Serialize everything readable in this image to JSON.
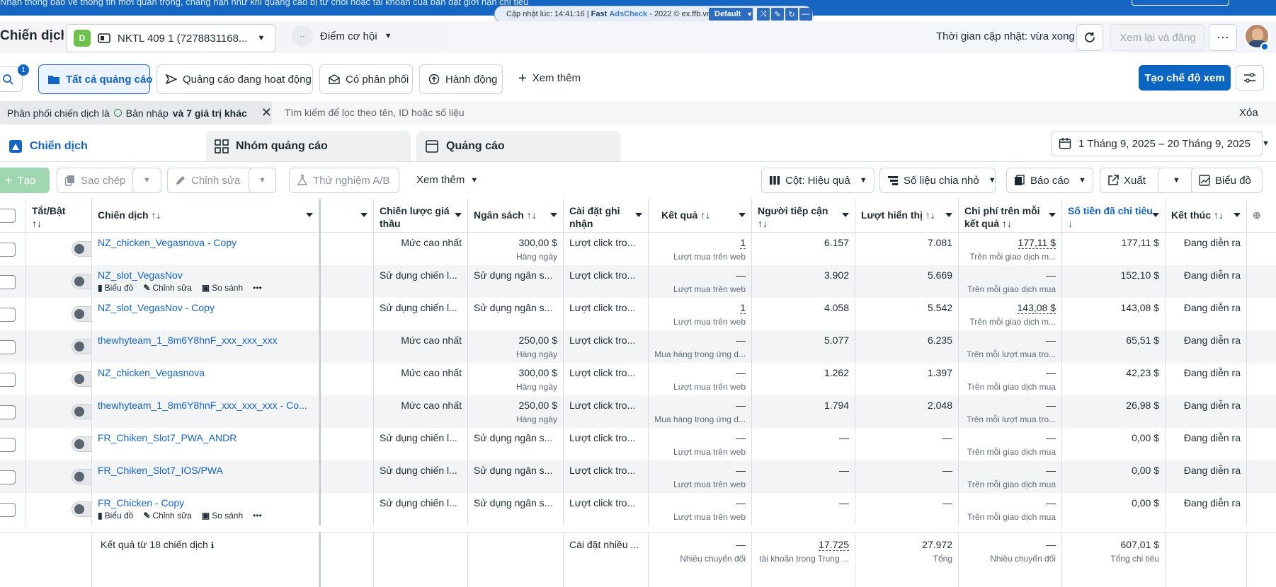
{
  "banner": {
    "message": "Nhận thông báo về thông tin mới quan trọng, chẳng hạn như khi quảng cáo bị từ chối hoặc tài khoản của bạn đặt giới hạn chi tiêu"
  },
  "extension": {
    "updated": "Cập nhật lúc: 14:41:16 |",
    "brand_a": "Fast",
    "brand_b": "AdsCheck",
    "copy": "- 2022 © ex.ffb.vn",
    "preset": "Default"
  },
  "header": {
    "title": "Chiến dịch",
    "account_badge": "D",
    "account_name": "NKTL 409 1 (7278831168...",
    "opportunity": "Điểm cơ hội",
    "update_time": "Thời gian cập nhật: vừa xong",
    "review_publish": "Xem lại và đăng"
  },
  "filters_bar": {
    "search_badge": "1",
    "tabs": [
      "Tất cả quảng cáo",
      "Quảng cáo đang hoạt động",
      "Có phân phối",
      "Hành động"
    ],
    "more": "Xem thêm",
    "create_view": "Tạo chế độ xem"
  },
  "filter_chip": {
    "prefix": "Phân phối chiến dịch là",
    "value": "Bản nháp",
    "more": "và 7 giá trị khác",
    "search_placeholder": "Tìm kiếm để lọc theo tên, ID hoặc số liệu",
    "clear": "Xóa"
  },
  "level_tabs": [
    "Chiến dịch",
    "Nhóm quảng cáo",
    "Quảng cáo"
  ],
  "date_range": "1 Tháng 9, 2025 – 20 Tháng 9, 2025",
  "toolbar": {
    "create": "Tạo",
    "duplicate": "Sao chép",
    "edit": "Chỉnh sửa",
    "ab_test": "Thử nghiệm A/B",
    "more": "Xem thêm",
    "columns": "Cột: Hiệu quả",
    "breakdown": "Số liệu chia nhỏ",
    "reports": "Báo cáo",
    "export": "Xuất",
    "charts": "Biểu đồ"
  },
  "columns": {
    "toggle": "Tắt/Bật",
    "toggle_sort": "↑↓",
    "name": "Chiến dịch ↑↓",
    "bid": "Chiến lược giá thầu",
    "budget": "Ngân sách ↑↓",
    "attribution": "Cài đặt ghi nhận",
    "results": "Kết quả ↑↓",
    "reach": "Người tiếp cận",
    "reach_sort": "↑↓",
    "impressions": "Lượt hiển thị ↑↓",
    "cpr": "Chi phí trên mỗi kết quả ↑↓",
    "spent": "Số tiền đã chi tiêu ↓",
    "ends": "Kết thúc ↑↓"
  },
  "row_actions": {
    "chart": "Biểu đồ",
    "edit": "Chỉnh sửa",
    "compare": "So sánh"
  },
  "rows": [
    {
      "name": "NZ_chicken_Vegasnova - Copy",
      "bid": "Mức cao nhất",
      "budget": "300,00 $",
      "budget_sub": "Hàng ngày",
      "attr": "Lượt click tro...",
      "result": "1",
      "result_sub": "Lượt mua trên web",
      "reach": "6.157",
      "impr": "7.081",
      "cpr": "177,11 $",
      "cpr_sub": "Trên mỗi giao dịch m...",
      "spent": "177,11 $",
      "ends": "Đang diễn ra"
    },
    {
      "name": "NZ_slot_VegasNov",
      "bid": "Sử dụng chiến l...",
      "budget": "Sử dụng ngân s...",
      "budget_sub": "",
      "attr": "Lượt click tro...",
      "result": "—",
      "result_sub": "Lượt mua trên web",
      "reach": "3.902",
      "impr": "5.669",
      "cpr": "—",
      "cpr_sub": "Trên mỗi giao dịch mua",
      "spent": "152,10 $",
      "ends": "Đang diễn ra"
    },
    {
      "name": "NZ_slot_VegasNov - Copy",
      "bid": "Sử dụng chiến l...",
      "budget": "Sử dụng ngân s...",
      "budget_sub": "",
      "attr": "Lượt click tro...",
      "result": "1",
      "result_sub": "Lượt mua trên web",
      "reach": "4.058",
      "impr": "5.542",
      "cpr": "143,08 $",
      "cpr_sub": "Trên mỗi giao dịch m...",
      "spent": "143,08 $",
      "ends": "Đang diễn ra"
    },
    {
      "name": "thewhyteam_1_8m6Y8hnF_xxx_xxx_xxx",
      "bid": "Mức cao nhất",
      "budget": "250,00 $",
      "budget_sub": "Hàng ngày",
      "attr": "Lượt click tro...",
      "result": "—",
      "result_sub": "Mua hàng trong ứng d...",
      "reach": "5.077",
      "impr": "6.235",
      "cpr": "—",
      "cpr_sub": "Trên mỗi lượt mua tro...",
      "spent": "65,51 $",
      "ends": "Đang diễn ra"
    },
    {
      "name": "NZ_chicken_Vegasnova",
      "bid": "Mức cao nhất",
      "budget": "300,00 $",
      "budget_sub": "Hàng ngày",
      "attr": "Lượt click tro...",
      "result": "—",
      "result_sub": "Lượt mua trên web",
      "reach": "1.262",
      "impr": "1.397",
      "cpr": "—",
      "cpr_sub": "Trên mỗi giao dịch mua",
      "spent": "42,23 $",
      "ends": "Đang diễn ra"
    },
    {
      "name": "thewhyteam_1_8m6Y8hnF_xxx_xxx_xxx - Co...",
      "bid": "Mức cao nhất",
      "budget": "250,00 $",
      "budget_sub": "Hàng ngày",
      "attr": "Lượt click tro...",
      "result": "—",
      "result_sub": "Mua hàng trong ứng d...",
      "reach": "1.794",
      "impr": "2.048",
      "cpr": "—",
      "cpr_sub": "Trên mỗi lượt mua tro...",
      "spent": "26,98 $",
      "ends": "Đang diễn ra"
    },
    {
      "name": "FR_Chiken_Slot7_PWA_ANDR",
      "bid": "Sử dụng chiến l...",
      "budget": "Sử dụng ngân s...",
      "budget_sub": "",
      "attr": "Lượt click tro...",
      "result": "—",
      "result_sub": "Lượt mua trên web",
      "reach": "—",
      "impr": "—",
      "cpr": "—",
      "cpr_sub": "Trên mỗi giao dịch mua",
      "spent": "0,00 $",
      "ends": "Đang diễn ra"
    },
    {
      "name": "FR_Chiken_Slot7_IOS/PWA",
      "bid": "Sử dụng chiến l...",
      "budget": "Sử dụng ngân s...",
      "budget_sub": "",
      "attr": "Lượt click tro...",
      "result": "—",
      "result_sub": "Lượt mua trên web",
      "reach": "—",
      "impr": "—",
      "cpr": "—",
      "cpr_sub": "Trên mỗi giao dịch mua",
      "spent": "0,00 $",
      "ends": "Đang diễn ra"
    },
    {
      "name": "FR_Chicken - Copy",
      "bid": "Sử dụng chiến l...",
      "budget": "Sử dụng ngân s...",
      "budget_sub": "",
      "attr": "Lượt click tro...",
      "result": "—",
      "result_sub": "Lượt mua trên web",
      "reach": "—",
      "impr": "—",
      "cpr": "—",
      "cpr_sub": "Trên mỗi giao dịch mua",
      "spent": "0,00 $",
      "ends": "Đang diễn ra"
    }
  ],
  "footer": {
    "label": "Kết quả từ 18 chiến dịch",
    "attr": "Cài đặt nhiều ...",
    "result": "—",
    "result_sub": "Nhiều chuyển đổi",
    "reach": "17.725",
    "reach_sub": "tài khoản trong Trung ...",
    "impr": "27.972",
    "impr_sub": "Tổng",
    "cpr": "—",
    "cpr_sub": "Nhiều chuyển đổi",
    "spent": "607,01 $",
    "spent_sub": "Tổng chi tiêu"
  },
  "colors": {
    "primary": "#0a66c2",
    "link": "#1464c6",
    "topbar": "#1466c2"
  }
}
